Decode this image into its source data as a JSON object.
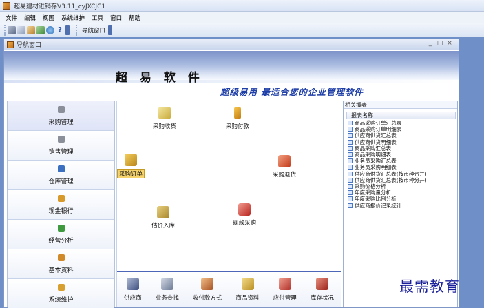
{
  "window": {
    "title": "超易建材进销存V3.11_cyJXCJC1"
  },
  "menu": [
    "文件",
    "编辑",
    "视图",
    "系统维护",
    "工具",
    "窗口",
    "帮助"
  ],
  "toolbar": {
    "nav_label": "导航窗口"
  },
  "nav_window": {
    "title": "导航窗口",
    "controls": [
      "_",
      "□",
      "×"
    ],
    "brand": "超 易 软 件",
    "slogan": "超级易用  最适合您的企业管理软件"
  },
  "modules": [
    {
      "label": "采购管理",
      "color": "#8a8f99"
    },
    {
      "label": "销售管理",
      "color": "#8a8f99"
    },
    {
      "label": "仓库管理",
      "color": "#3b6fc0"
    },
    {
      "label": "现金银行",
      "color": "#d89a2a"
    },
    {
      "label": "经营分析",
      "color": "#3f9a3f"
    },
    {
      "label": "基本资料",
      "color": "#d08a2a"
    },
    {
      "label": "系统维护",
      "color": "#d8a030"
    }
  ],
  "flow": [
    {
      "label": "采购收货",
      "color": "#d7c25a"
    },
    {
      "label": "采购付款",
      "color": "#e0a020"
    },
    {
      "label": "采购订单",
      "color": "#e8b030"
    },
    {
      "label": "采购退货",
      "color": "#d04a2a"
    },
    {
      "label": "估价入库",
      "color": "#c9a23a"
    },
    {
      "label": "现款采购",
      "color": "#cc3a30"
    }
  ],
  "bottom_tools": [
    {
      "label": "供应商",
      "color": "#5a6fa0"
    },
    {
      "label": "业务查找",
      "color": "#7f8da8"
    },
    {
      "label": "收付款方式",
      "color": "#c06a30"
    },
    {
      "label": "商品资料",
      "color": "#d4a93a"
    },
    {
      "label": "应付管理",
      "color": "#c84a3a"
    },
    {
      "label": "库存状况",
      "color": "#b8362a"
    }
  ],
  "reports": {
    "header": "相关报表",
    "column": "报表名称",
    "items": [
      "商品采购订单汇总表",
      "商品采购订单明细表",
      "供应商供货汇总表",
      "供应商供货明细表",
      "商品采购汇总表",
      "商品采购明细表",
      "业务员采购汇总表",
      "业务员采购明细表",
      "供应商供货汇总表(按币种合并)",
      "供应商供货汇总表(按币种分开)",
      "采购价格分析",
      "年度采购量分析",
      "年度采购比例分析",
      "供应商报价记录统计"
    ]
  },
  "watermark": "最需教育"
}
